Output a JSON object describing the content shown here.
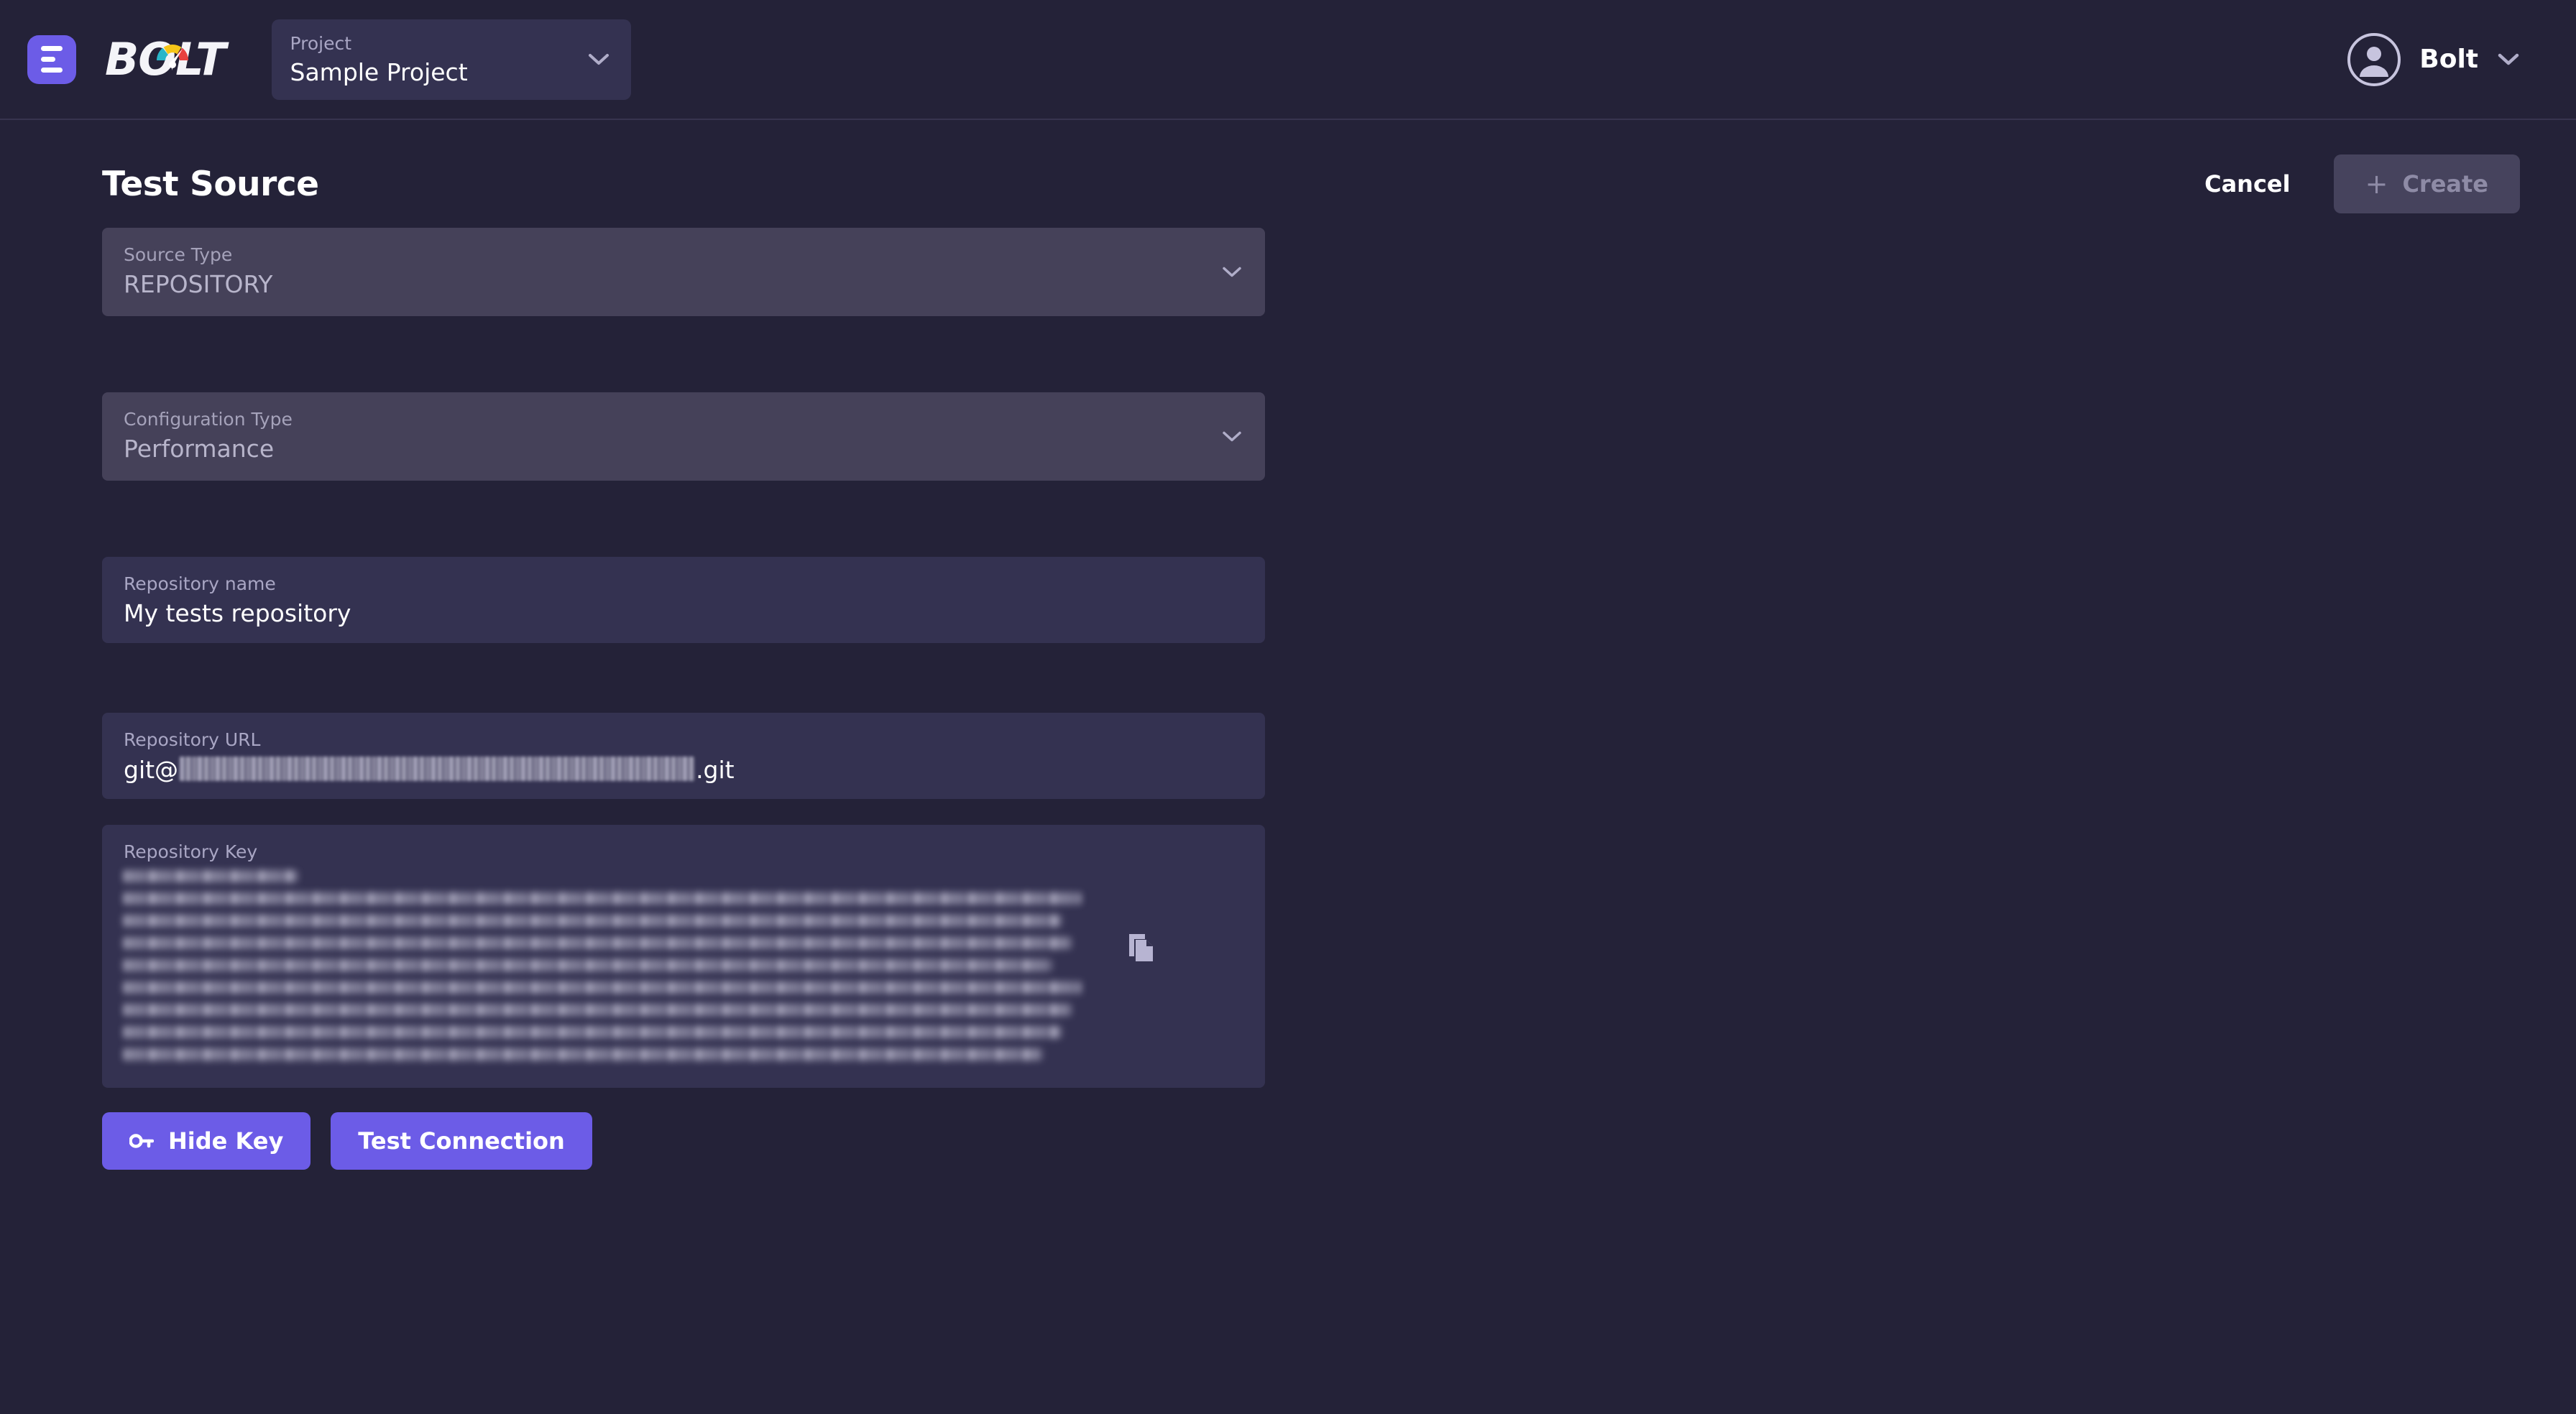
{
  "theme": {
    "page_bg": "#242238",
    "header_bg": "#242238",
    "field_bg_enabled": "#343251",
    "field_bg_disabled": "#454159",
    "accent": "#6c5ce7",
    "text_primary": "#ffffff",
    "text_muted": "#a9a6c4",
    "disabled_text": "#8e8ba6",
    "divider": "#37344f"
  },
  "header": {
    "menu_icon": "hamburger-menu-icon",
    "logo_text": "BOLT",
    "logo_mark": "speedometer-gauge-icon",
    "project": {
      "label": "Project",
      "value": "Sample Project",
      "chevron_icon": "chevron-down-icon"
    },
    "user": {
      "avatar_icon": "user-avatar-icon",
      "name": "Bolt",
      "chevron_icon": "chevron-down-icon"
    }
  },
  "page": {
    "title": "Test Source",
    "cancel_label": "Cancel",
    "create_label": "Create",
    "create_plus_icon": "plus-icon",
    "create_disabled": true
  },
  "form": {
    "source_type": {
      "label": "Source Type",
      "value": "REPOSITORY",
      "disabled": true,
      "chevron_icon": "chevron-down-icon"
    },
    "configuration_type": {
      "label": "Configuration Type",
      "value": "Performance",
      "disabled": true,
      "chevron_icon": "chevron-down-icon"
    },
    "repository_name": {
      "label": "Repository name",
      "value": "My tests repository",
      "disabled": false
    },
    "repository_url": {
      "label": "Repository URL",
      "value_prefix": "git@",
      "value_suffix": ".git",
      "masked": true
    },
    "repository_key": {
      "label": "Repository Key",
      "masked": true,
      "line_widths": [
        18,
        99,
        97,
        98,
        96,
        99,
        98,
        97,
        95,
        99,
        96,
        98,
        62
      ],
      "copy_icon": "copy-icon",
      "copy_title": "Copy"
    },
    "actions": {
      "hide_key_label": "Hide Key",
      "hide_key_icon": "key-icon",
      "test_connection_label": "Test Connection"
    }
  }
}
